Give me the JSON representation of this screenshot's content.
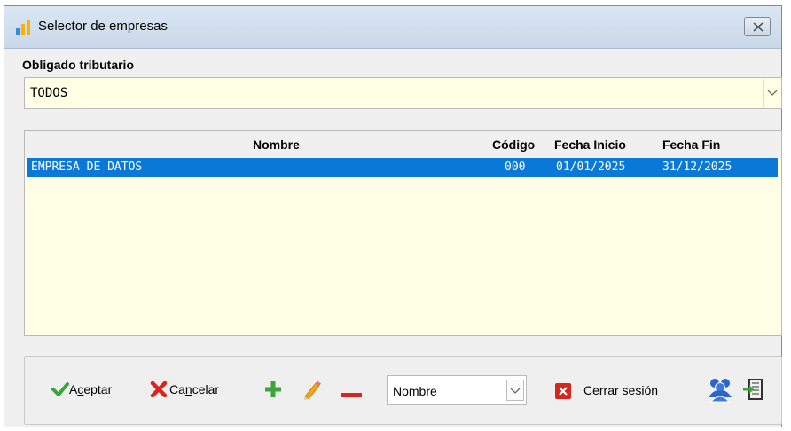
{
  "window": {
    "title": "Selector de empresas",
    "close_glyph": "✕"
  },
  "obligado": {
    "label": "Obligado tributario",
    "value": "TODOS"
  },
  "grid": {
    "columns": [
      "Nombre",
      "Código",
      "Fecha Inicio",
      "Fecha Fin"
    ],
    "rows": [
      {
        "nombre": "EMPRESA DE DATOS",
        "codigo": "000",
        "inicio": "01/01/2025",
        "fin": "31/12/2025",
        "selected": true
      }
    ]
  },
  "toolbar": {
    "aceptar": {
      "pre": "A",
      "mnemonic": "c",
      "post": "eptar"
    },
    "cancelar": {
      "pre": "Ca",
      "mnemonic": "n",
      "post": "celar"
    },
    "sort_value": "Nombre",
    "cerrar_sesion": "Cerrar sesión"
  },
  "colors": {
    "selection": "#0a78d6",
    "field_bg": "#ffffe6",
    "green": "#3aa53a",
    "red": "#d9261c",
    "blue_users": "#2a66c8"
  },
  "icons": [
    "app-chart-icon",
    "check-icon",
    "cross-icon",
    "add-icon",
    "edit-pencil-icon",
    "remove-icon",
    "close-square-icon",
    "users-icon",
    "exit-icon",
    "chevron-down-icon"
  ]
}
